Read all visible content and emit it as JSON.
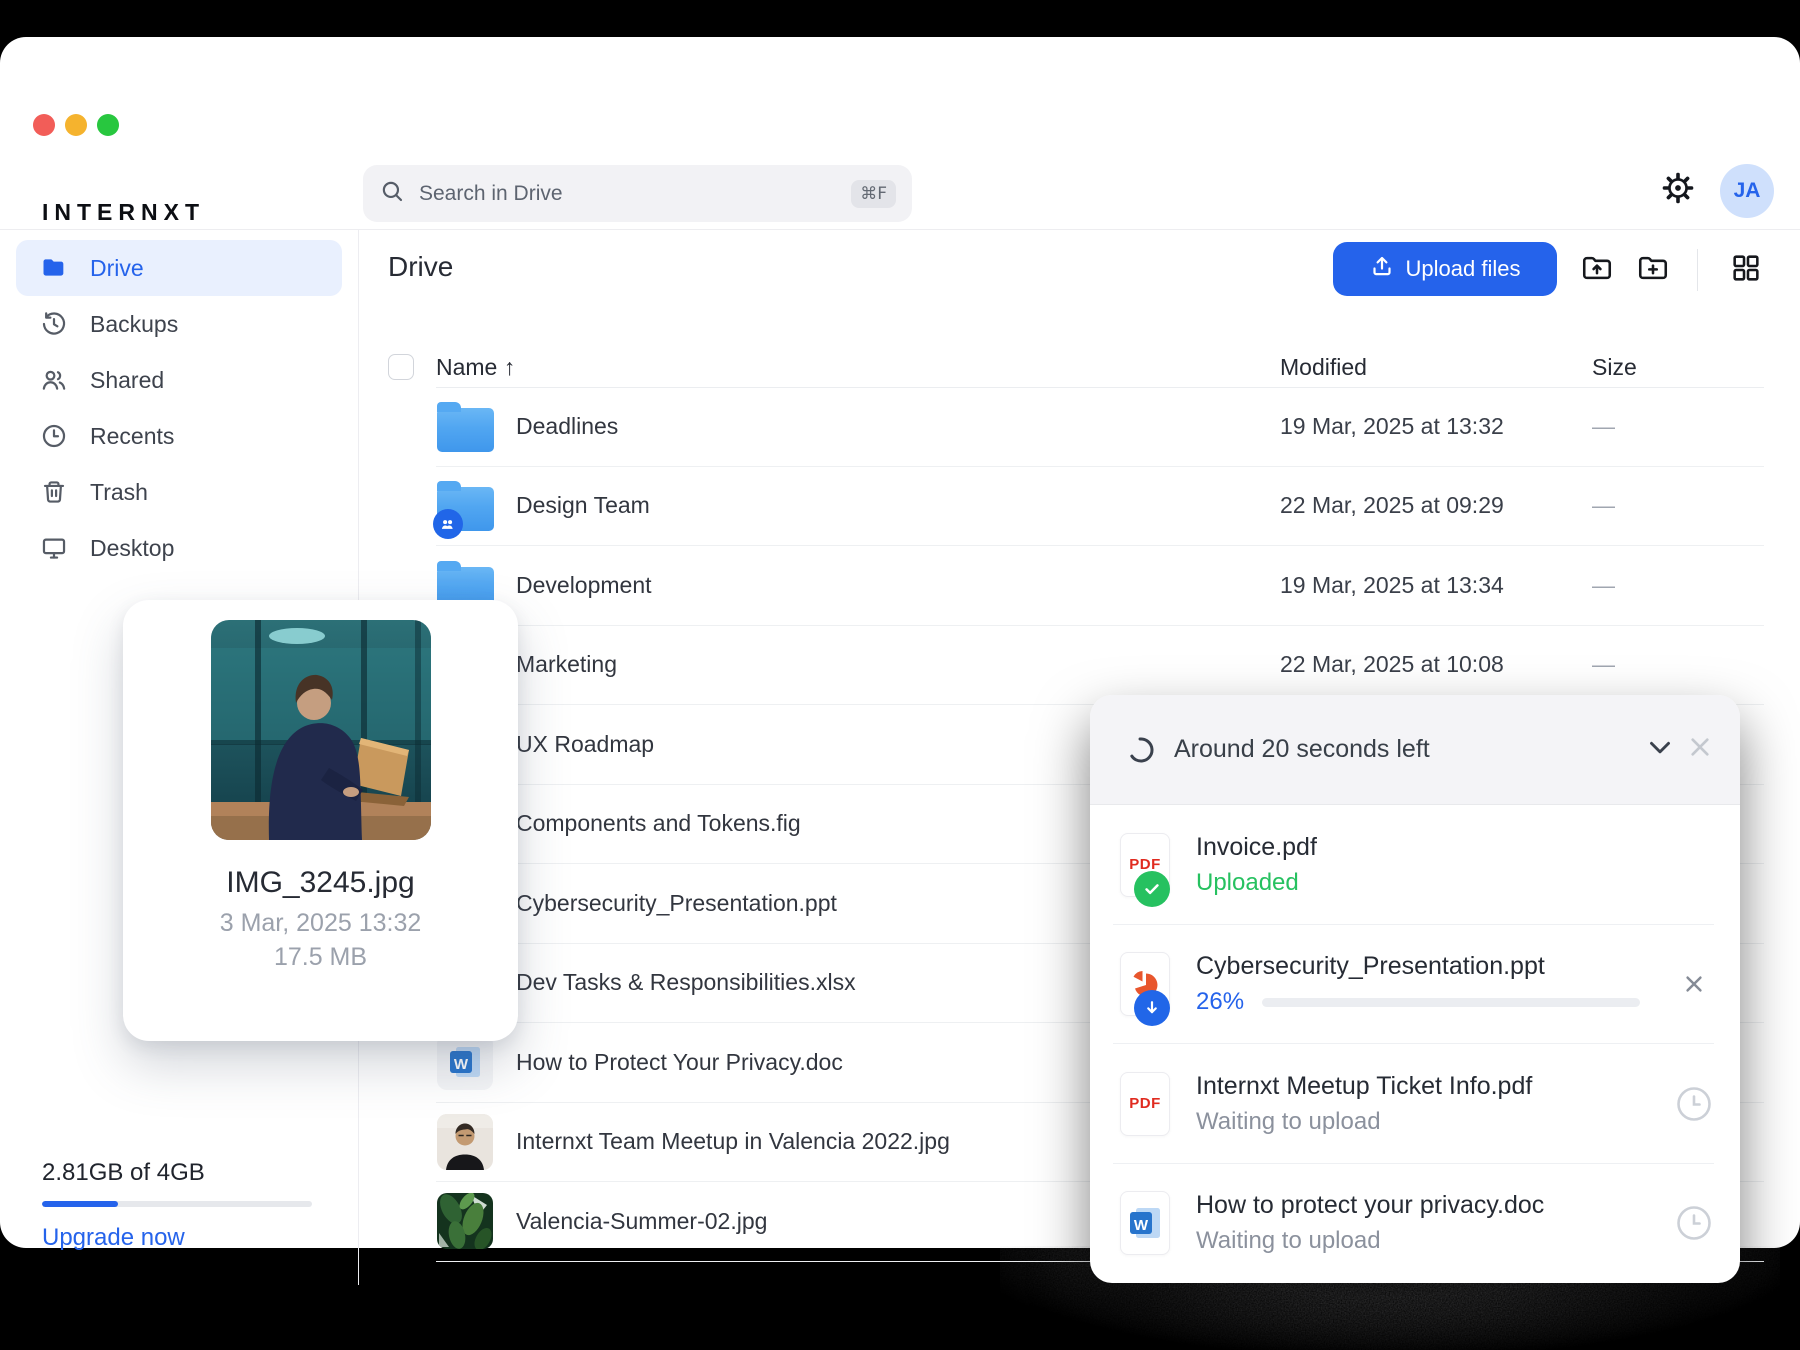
{
  "window": {
    "traffic_lights": [
      "#f25d58",
      "#f5b32e",
      "#28c73f"
    ]
  },
  "brand": {
    "logo": "INTERNXT"
  },
  "header": {
    "search_placeholder": "Search in Drive",
    "search_shortcut": "⌘F",
    "avatar_initials": "JA"
  },
  "sidebar": {
    "items": [
      {
        "label": "Drive",
        "icon": "drive-folder",
        "active": true
      },
      {
        "label": "Backups",
        "icon": "backups",
        "active": false
      },
      {
        "label": "Shared",
        "icon": "shared",
        "active": false
      },
      {
        "label": "Recents",
        "icon": "recents",
        "active": false
      },
      {
        "label": "Trash",
        "icon": "trash",
        "active": false
      },
      {
        "label": "Desktop",
        "icon": "desktop",
        "active": false
      }
    ],
    "storage": {
      "usage": "2.81GB of 4GB",
      "percent_used": 28,
      "upgrade": "Upgrade now"
    }
  },
  "main": {
    "title": "Drive",
    "upload_button": "Upload files",
    "columns": {
      "name": "Name",
      "sort_arrow": "↑",
      "modified": "Modified",
      "size": "Size"
    },
    "rows": [
      {
        "name": "Deadlines",
        "icon": "folder",
        "modified": "19 Mar, 2025 at 13:32",
        "size": "—"
      },
      {
        "name": "Design Team",
        "icon": "folder-shared",
        "modified": "22 Mar, 2025 at 09:29",
        "size": "—"
      },
      {
        "name": "Development",
        "icon": "folder",
        "modified": "19 Mar, 2025 at 13:34",
        "size": "—"
      },
      {
        "name": "Marketing",
        "icon": "folder",
        "modified": "22 Mar, 2025 at 10:08",
        "size": "—"
      },
      {
        "name": "UX Roadmap",
        "icon": "folder",
        "modified": "",
        "size": ""
      },
      {
        "name": "Components and Tokens.fig",
        "icon": "file",
        "modified": "",
        "size": ""
      },
      {
        "name": "Cybersecurity_Presentation.ppt",
        "icon": "file",
        "modified": "",
        "size": ""
      },
      {
        "name": "Dev Tasks & Responsibilities.xlsx",
        "icon": "file",
        "modified": "",
        "size": ""
      },
      {
        "name": "How to Protect Your Privacy.doc",
        "icon": "file-doc",
        "modified": "",
        "size": ""
      },
      {
        "name": "Internxt Team Meetup in Valencia 2022.jpg",
        "icon": "thumb-person",
        "modified": "",
        "size": ""
      },
      {
        "name": "Valencia-Summer-02.jpg",
        "icon": "thumb-leaves",
        "modified": "",
        "size": ""
      }
    ]
  },
  "preview_card": {
    "filename": "IMG_3245.jpg",
    "date": "3 Mar, 2025 13:32",
    "size": "17.5 MB"
  },
  "upload_panel": {
    "header": "Around 20 seconds left",
    "items": [
      {
        "name": "Invoice.pdf",
        "icon": "pdf",
        "state": "done",
        "status": "Uploaded"
      },
      {
        "name": "Cybersecurity_Presentation.ppt",
        "icon": "ppt",
        "state": "uploading",
        "progress_label": "26%",
        "progress_percent": 26
      },
      {
        "name": "Internxt Meetup Ticket Info.pdf",
        "icon": "pdf",
        "state": "waiting",
        "status": "Waiting to upload"
      },
      {
        "name": "How to protect your privacy.doc",
        "icon": "doc",
        "state": "waiting",
        "status": "Waiting to upload"
      }
    ]
  },
  "colors": {
    "accent": "#2563eb",
    "green": "#26c160",
    "red": "#e02b20",
    "orange": "#e8562d"
  }
}
